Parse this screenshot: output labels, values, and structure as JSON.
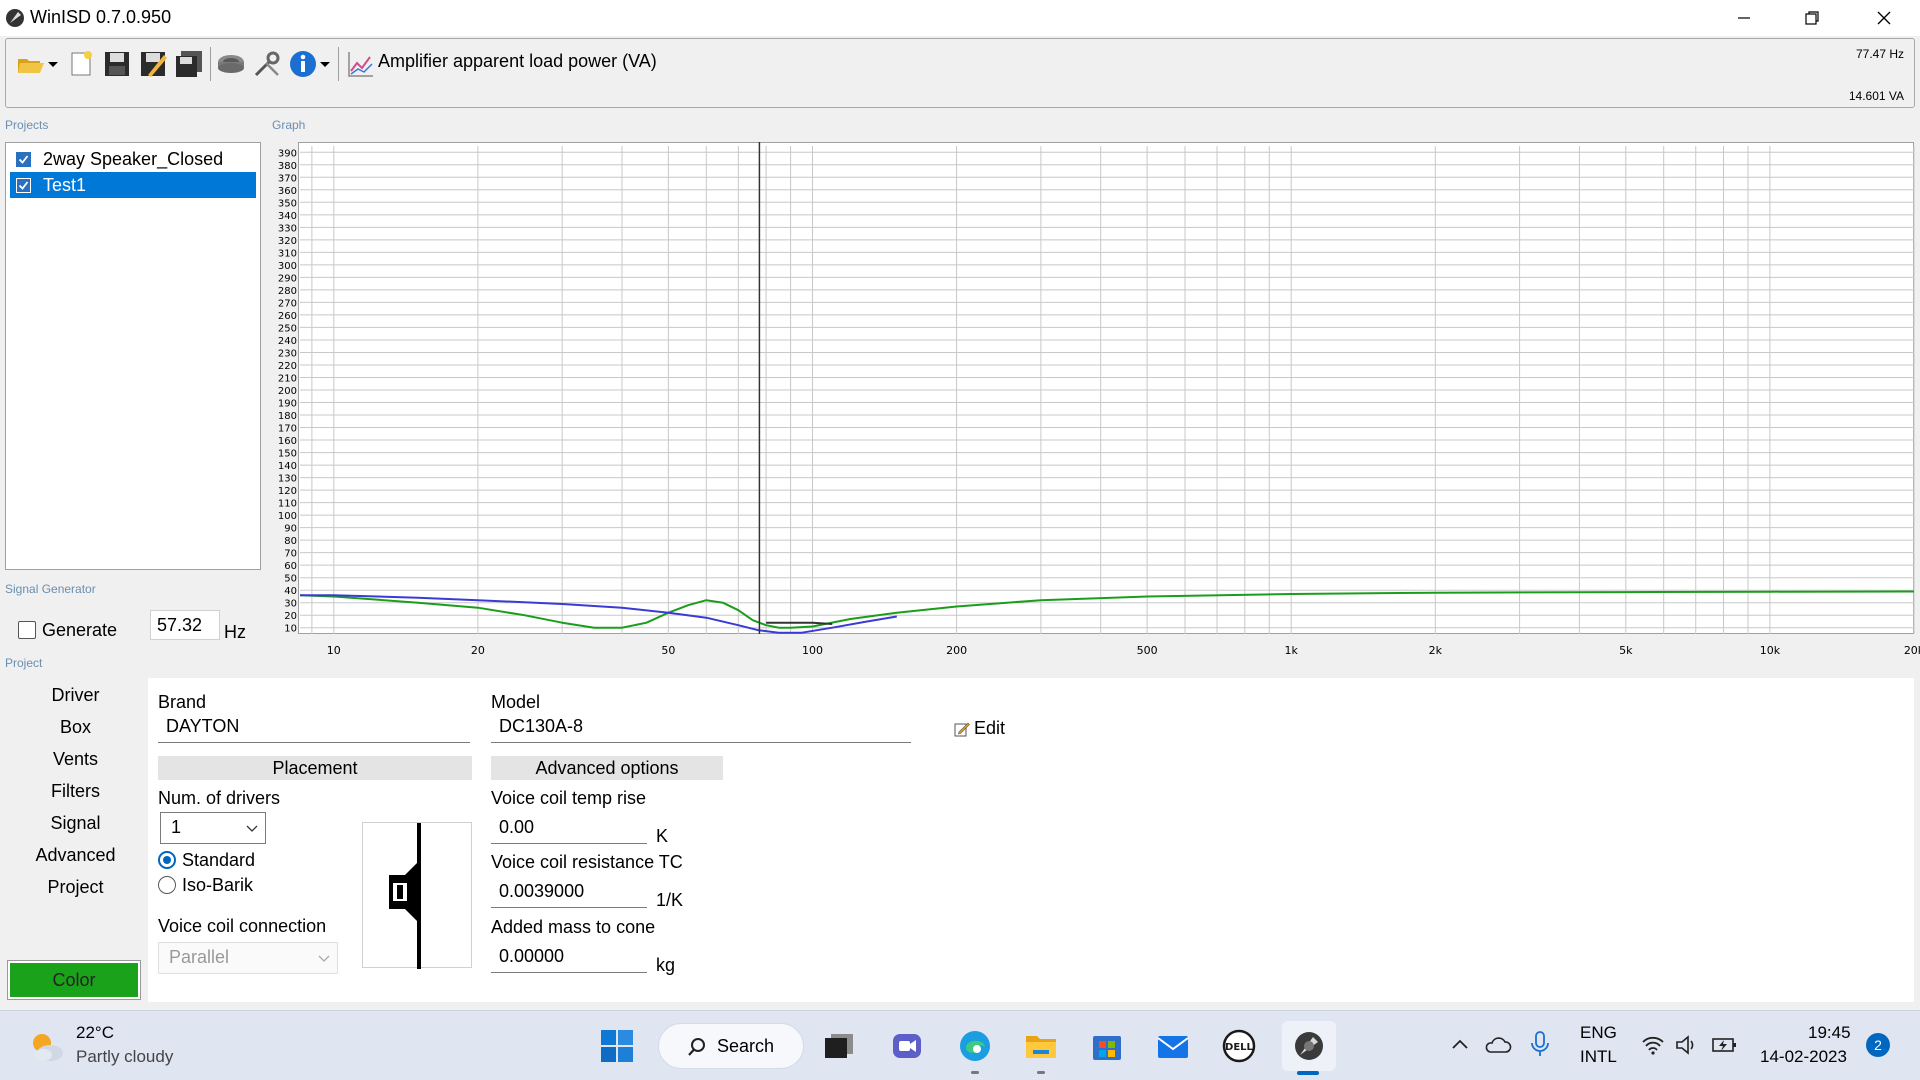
{
  "window": {
    "title": "WinISD 0.7.0.950"
  },
  "toolbar": {
    "graph_selected": "Amplifier apparent load power (VA)",
    "readout_frequency": "77.47 Hz",
    "readout_value": "14.601 VA"
  },
  "sections": {
    "projects": "Projects",
    "graph": "Graph",
    "signal_generator": "Signal Generator",
    "project": "Project"
  },
  "projects": [
    {
      "name": "2way Speaker_Closed",
      "checked": true,
      "selected": false
    },
    {
      "name": "Test1",
      "checked": true,
      "selected": true
    }
  ],
  "signal_generator": {
    "generate_label": "Generate",
    "frequency": "57.32",
    "unit": "Hz"
  },
  "chart_data": {
    "type": "line",
    "x_scale": "log",
    "xlim": [
      8.5,
      20000
    ],
    "ylim": [
      5,
      395
    ],
    "y_ticks": [
      10,
      20,
      30,
      40,
      50,
      60,
      70,
      80,
      90,
      100,
      110,
      120,
      130,
      140,
      150,
      160,
      170,
      180,
      190,
      200,
      210,
      220,
      230,
      240,
      250,
      260,
      270,
      280,
      290,
      300,
      310,
      320,
      330,
      340,
      350,
      360,
      370,
      380,
      390
    ],
    "x_ticks": [
      {
        "value": 10,
        "label": "10"
      },
      {
        "value": 20,
        "label": "20"
      },
      {
        "value": 50,
        "label": "50"
      },
      {
        "value": 100,
        "label": "100"
      },
      {
        "value": 200,
        "label": "200"
      },
      {
        "value": 500,
        "label": "500"
      },
      {
        "value": 1000,
        "label": "1k"
      },
      {
        "value": 2000,
        "label": "2k"
      },
      {
        "value": 5000,
        "label": "5k"
      },
      {
        "value": 10000,
        "label": "10k"
      },
      {
        "value": 20000,
        "label": "20k"
      }
    ],
    "grid": true,
    "cursor_x": 77.47,
    "series": [
      {
        "color": "#1a9e1a",
        "points": [
          [
            8.5,
            36
          ],
          [
            10,
            35
          ],
          [
            15,
            30
          ],
          [
            20,
            26
          ],
          [
            25,
            20
          ],
          [
            30,
            14
          ],
          [
            35,
            10
          ],
          [
            40,
            10
          ],
          [
            45,
            14
          ],
          [
            50,
            22
          ],
          [
            55,
            28
          ],
          [
            60,
            32
          ],
          [
            65,
            30
          ],
          [
            70,
            24
          ],
          [
            75,
            16
          ],
          [
            80,
            12
          ],
          [
            85,
            10
          ],
          [
            90,
            10
          ],
          [
            100,
            11
          ],
          [
            120,
            17
          ],
          [
            150,
            22
          ],
          [
            200,
            27
          ],
          [
            300,
            32
          ],
          [
            500,
            35
          ],
          [
            1000,
            37
          ],
          [
            2000,
            38
          ],
          [
            5000,
            38.5
          ],
          [
            10000,
            38.8
          ],
          [
            20000,
            39
          ]
        ]
      },
      {
        "color": "#3a3ad6",
        "points": [
          [
            8.5,
            36
          ],
          [
            10,
            36
          ],
          [
            15,
            34
          ],
          [
            20,
            32
          ],
          [
            30,
            29
          ],
          [
            40,
            26
          ],
          [
            50,
            22
          ],
          [
            60,
            18
          ],
          [
            70,
            12
          ],
          [
            77,
            8
          ],
          [
            85,
            6
          ],
          [
            95,
            6
          ],
          [
            110,
            10
          ],
          [
            130,
            15
          ],
          [
            150,
            19
          ]
        ]
      },
      {
        "color": "#333333",
        "points": [
          [
            80,
            14
          ],
          [
            90,
            14
          ],
          [
            100,
            14
          ],
          [
            110,
            13
          ]
        ]
      }
    ]
  },
  "nav": [
    "Driver",
    "Box",
    "Vents",
    "Filters",
    "Signal",
    "Advanced",
    "Project"
  ],
  "nav_active": 0,
  "color_button": {
    "label": "Color",
    "color": "#1aa31a"
  },
  "driver": {
    "brand_label": "Brand",
    "brand_value": "DAYTON",
    "model_label": "Model",
    "model_value": "DC130A-8",
    "edit_label": "Edit",
    "placement_header": "Placement",
    "num_drivers_label": "Num. of drivers",
    "num_drivers_value": "1",
    "placement_standard": "Standard",
    "placement_isobarik": "Iso-Barik",
    "placement_selected": "Standard",
    "voice_coil_connection_label": "Voice coil connection",
    "voice_coil_connection_value": "Parallel",
    "advanced_header": "Advanced options",
    "vc_temp_rise_label": "Voice coil temp rise",
    "vc_temp_rise_value": "0.00",
    "vc_temp_rise_unit": "K",
    "vc_resistance_tc_label": "Voice coil resistance TC",
    "vc_resistance_tc_value": "0.0039000",
    "vc_resistance_tc_unit": "1/K",
    "added_mass_label": "Added mass to cone",
    "added_mass_value": "0.00000",
    "added_mass_unit": "kg"
  },
  "taskbar": {
    "weather_temp": "22°C",
    "weather_desc": "Partly cloudy",
    "search_label": "Search",
    "lang_line1": "ENG",
    "lang_line2": "INTL",
    "time": "19:45",
    "date": "14-02-2023",
    "notification_count": "2"
  }
}
